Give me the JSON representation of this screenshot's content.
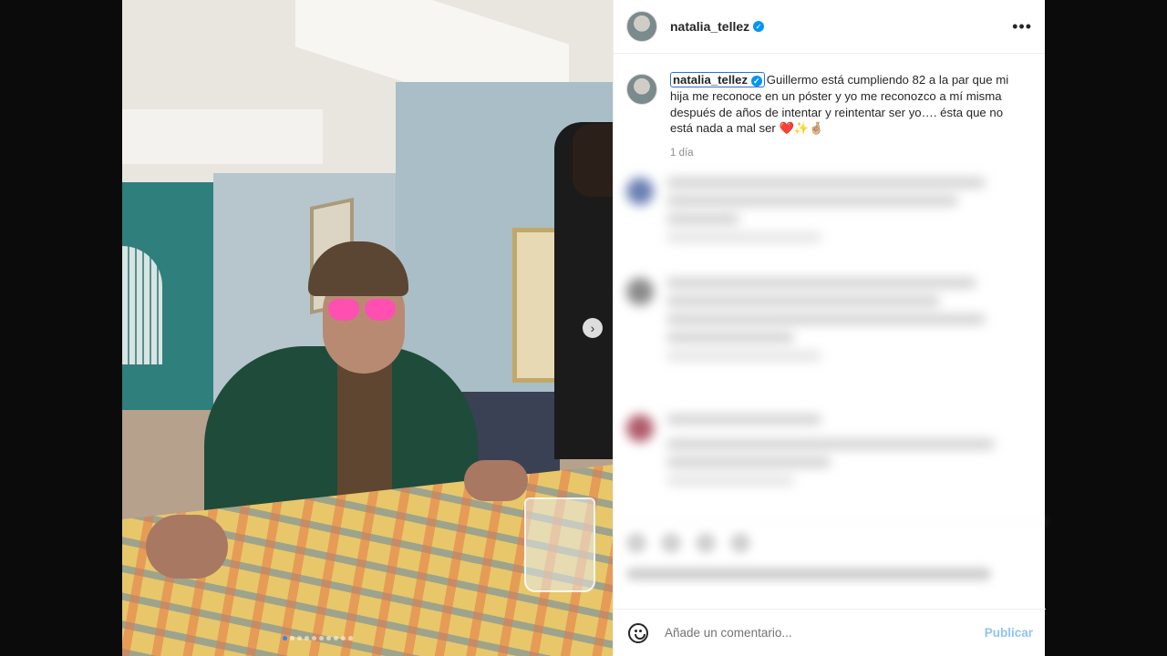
{
  "post": {
    "username": "natalia_tellez",
    "verified_icon": "verified-badge-icon",
    "more_icon": "more-options-icon"
  },
  "caption": {
    "username": "natalia_tellez",
    "text": "Guillermo está cumpliendo 82 a la par que mi hija me reconoce en un póster y yo me reconozco a mí misma después de años de intentar y reintentar ser yo…. ésta que no está nada a mal ser ❤️✨🤞🏼",
    "time": "1 día"
  },
  "carousel": {
    "next_icon": "chevron-right-icon",
    "slide_count": 10,
    "active_slide": 1
  },
  "comment_box": {
    "placeholder": "Añade un comentario...",
    "publish_label": "Publicar",
    "emoji_icon": "emoji-icon"
  },
  "colors": {
    "verified": "#0095f6",
    "publish": "#8fc3f7"
  }
}
